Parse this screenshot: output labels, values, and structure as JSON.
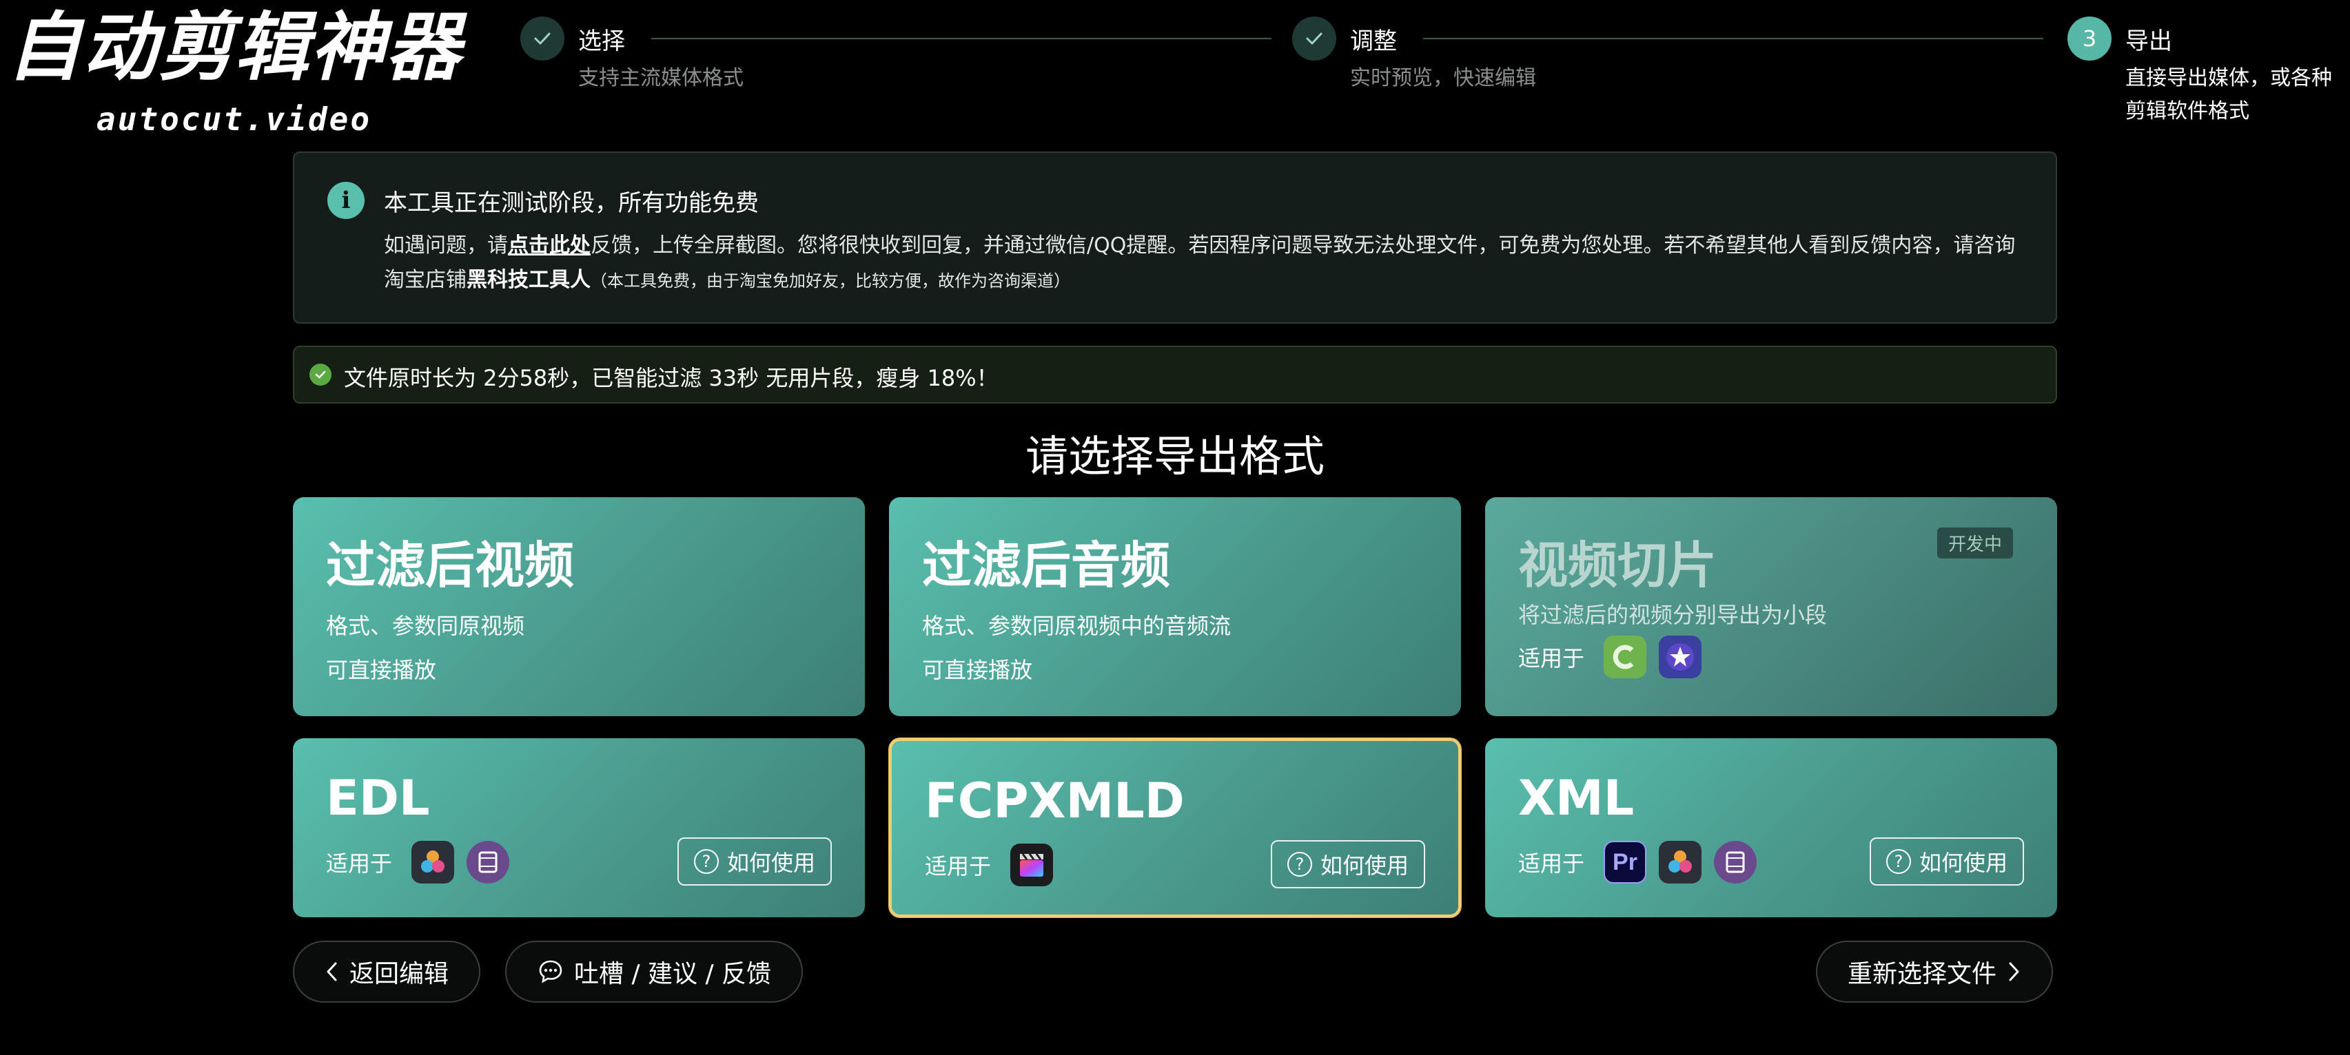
{
  "logo": {
    "title": "自动剪辑神器",
    "subtitle": "autocut.video"
  },
  "steps": [
    {
      "title": "选择",
      "desc": "支持主流媒体格式",
      "state": "done"
    },
    {
      "title": "调整",
      "desc": "实时预览，快速编辑",
      "state": "done"
    },
    {
      "number": "3",
      "title": "导出",
      "desc_line1": "直接导出媒体，或各种",
      "desc_line2": "剪辑软件格式",
      "state": "active"
    }
  ],
  "notice": {
    "title": "本工具正在测试阶段，所有功能免费",
    "p1": "如遇问题，请",
    "link": "点击此处",
    "p2": "反馈，上传全屏截图。您将很快收到回复，并通过微信/QQ提醒。若因程序问题导致无法处理文件，可免费为您处理。若不希望其他人看到反馈内容，请咨询淘宝店铺",
    "shop": "黑科技工具人",
    "note": "（本工具免费，由于淘宝免加好友，比较方便，故作为咨询渠道）"
  },
  "success": {
    "text": "文件原时长为 2分58秒，已智能过滤 33秒 无用片段，瘦身 18%！"
  },
  "heading": "请选择导出格式",
  "options": {
    "video": {
      "title": "过滤后视频",
      "line1": "格式、参数同原视频",
      "line2": "可直接播放"
    },
    "audio": {
      "title": "过滤后音频",
      "line1": "格式、参数同原视频中的音频流",
      "line2": "可直接播放"
    },
    "slices": {
      "title": "视频切片",
      "badge": "开发中",
      "line1": "将过滤后的视频分别导出为小段",
      "fit_label": "适用于",
      "apps": [
        "camtasia-icon",
        "imovie-icon"
      ]
    },
    "edl": {
      "title": "EDL",
      "fit_label": "适用于",
      "how_label": "如何使用",
      "apps": [
        "davinci-resolve-icon",
        "filmstrip-app-icon"
      ]
    },
    "fcpxmld": {
      "title": "FCPXMLD",
      "fit_label": "适用于",
      "how_label": "如何使用",
      "apps": [
        "final-cut-pro-icon"
      ],
      "selected": true
    },
    "xml": {
      "title": "XML",
      "fit_label": "适用于",
      "how_label": "如何使用",
      "apps": [
        "premiere-pro-icon",
        "davinci-resolve-icon",
        "filmstrip-app-icon"
      ],
      "pr_text": "Pr"
    }
  },
  "buttons": {
    "back": "返回编辑",
    "feedback": "吐槽 / 建议 / 反馈",
    "reselect": "重新选择文件"
  },
  "colors": {
    "accent": "#56b7a6",
    "card_start": "#59bfae",
    "card_end": "#3d7f77",
    "selected_border": "#f3cc73",
    "success": "#5aa942"
  }
}
